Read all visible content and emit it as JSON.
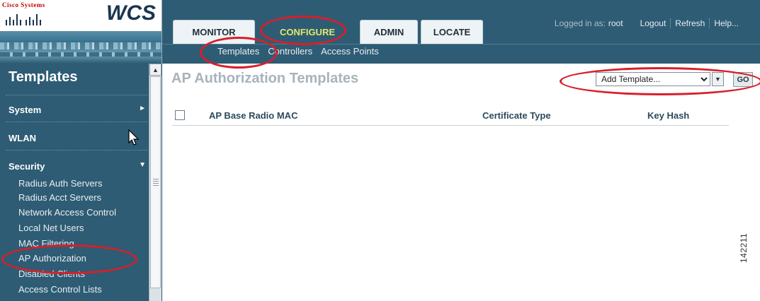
{
  "brand": {
    "company": "Cisco Systems",
    "product": "WCS"
  },
  "tabs": [
    {
      "label": "MONITOR",
      "active": false
    },
    {
      "label": "CONFIGURE",
      "active": true
    },
    {
      "label": "ADMIN",
      "active": false
    },
    {
      "label": "LOCATE",
      "active": false
    }
  ],
  "subnav": [
    "Templates",
    "Controllers",
    "Access Points"
  ],
  "userbar": {
    "logged_in_label": "Logged in as:",
    "username": "root",
    "links": [
      "Logout",
      "Refresh",
      "Help..."
    ]
  },
  "sidebar": {
    "title": "Templates",
    "sections": [
      {
        "label": "System",
        "expanded": false
      },
      {
        "label": "WLAN",
        "expanded": false
      },
      {
        "label": "Security",
        "expanded": true
      }
    ],
    "security_items": [
      "Radius Auth Servers",
      "Radius Acct Servers",
      "Network Access Control",
      "Local Net Users",
      "MAC Filtering",
      "AP Authorization",
      "Disabled Clients",
      "Access Control Lists"
    ]
  },
  "main": {
    "title": "AP Authorization Templates",
    "select": {
      "value": "Add Template...",
      "options": [
        "Add Template..."
      ]
    },
    "go_label": "GO",
    "columns": [
      "AP Base Radio MAC",
      "Certificate Type",
      "Key Hash"
    ],
    "rows": []
  },
  "figure_number": "142211",
  "colors": {
    "header_bg": "#2e5c74",
    "active_tab_text": "#dfe86a",
    "annotation_red": "#d81f2a",
    "page_title": "#a7b3bc"
  }
}
